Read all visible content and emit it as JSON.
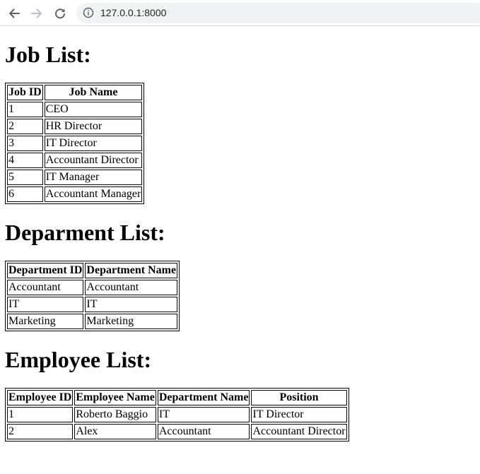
{
  "browser": {
    "url": "127.0.0.1:8000"
  },
  "job_section": {
    "title": "Job List:",
    "headers": [
      "Job ID",
      "Job Name"
    ],
    "rows": [
      [
        "1",
        "CEO"
      ],
      [
        "2",
        "HR Director"
      ],
      [
        "3",
        "IT Director"
      ],
      [
        "4",
        "Accountant Director"
      ],
      [
        "5",
        "IT Manager"
      ],
      [
        "6",
        "Accountant Manager"
      ]
    ]
  },
  "department_section": {
    "title": "Deparment List:",
    "headers": [
      "Department ID",
      "Department Name"
    ],
    "rows": [
      [
        "Accountant",
        "Accountant"
      ],
      [
        "IT",
        "IT"
      ],
      [
        "Marketing",
        "Marketing"
      ]
    ]
  },
  "employee_section": {
    "title": "Employee List:",
    "headers": [
      "Employee ID",
      "Employee Name",
      "Department Name",
      "Position"
    ],
    "rows": [
      [
        "1",
        "Roberto Baggio",
        "IT",
        "IT Director"
      ],
      [
        "2",
        "Alex",
        "Accountant",
        "Accountant Director"
      ]
    ]
  },
  "icons": {
    "back": "arrow-left-icon",
    "forward": "arrow-right-icon",
    "reload": "reload-icon",
    "site_info": "info-icon"
  },
  "colors": {
    "omnibox_background": "#f1f3f4",
    "nav_icon": "#5f6368",
    "nav_icon_disabled": "#bdc1c6",
    "text": "#000000"
  }
}
